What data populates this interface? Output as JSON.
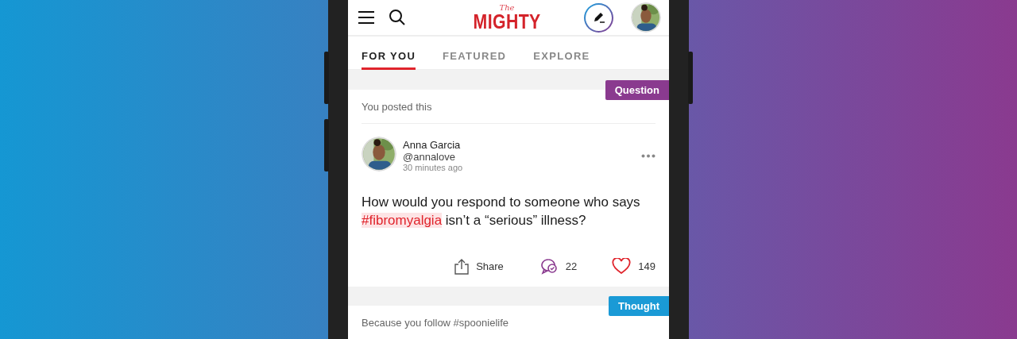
{
  "header": {
    "logo_small": "The",
    "logo_main": "MIGHTY"
  },
  "tabs": [
    {
      "label": "FOR YOU",
      "selected": true
    },
    {
      "label": "FEATURED",
      "selected": false
    },
    {
      "label": "EXPLORE",
      "selected": false
    }
  ],
  "feed": [
    {
      "badge": "Question",
      "color": "#8a3a8f",
      "context": "You posted this",
      "author": {
        "name": "Anna Garcia",
        "handle": "@annalove",
        "time": "30 minutes ago"
      },
      "body": [
        {
          "kind": "text",
          "text": "How would you respond to someone who says "
        },
        {
          "kind": "hashtag",
          "text": "#fibromyalgia"
        },
        {
          "kind": "text",
          "text": " isn’t a “serious” illness?"
        }
      ],
      "share": "Share",
      "comments": "22",
      "likes": "149"
    },
    {
      "badge": "Thought",
      "color": "#1a9ad6",
      "context": "Because you follow #spoonielife"
    }
  ]
}
